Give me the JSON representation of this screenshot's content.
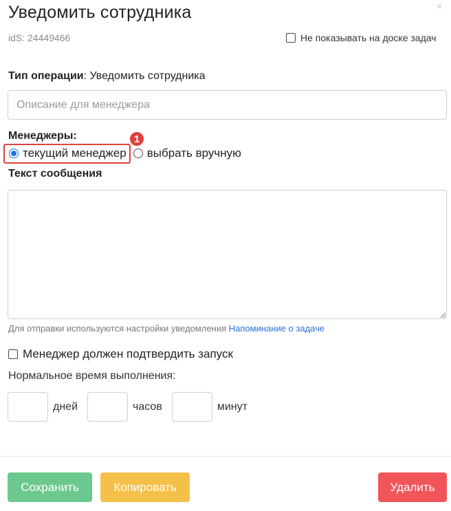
{
  "dialog": {
    "title": "Уведомить сотрудника",
    "close_glyph": "×",
    "ids_text": "idS: 24449466",
    "hide_checkbox_label": "Не показывать на доске задач",
    "hide_checkbox_checked": false
  },
  "operation": {
    "label": "Тип операции",
    "value": ": Уведомить сотрудника",
    "description_placeholder": "Описание для менеджера",
    "description_value": ""
  },
  "managers": {
    "label": "Менеджеры:",
    "options": [
      {
        "label": "текущий менеджер",
        "selected": true
      },
      {
        "label": "выбрать вручную",
        "selected": false
      }
    ],
    "annotation_badge": "1"
  },
  "message": {
    "label": "Текст сообщения",
    "value": "",
    "hint_prefix": "Для отправки используются настройки уведомления ",
    "hint_link": "Напоминание о задаче"
  },
  "confirm": {
    "label": "Менеджер должен подтвердить запуск",
    "checked": false
  },
  "normal_time": {
    "label": "Нормальное время выполнения:",
    "days_label": "дней",
    "hours_label": "часов",
    "minutes_label": "минут",
    "days_value": "",
    "hours_value": "",
    "minutes_value": ""
  },
  "buttons": {
    "save": "Сохранить",
    "copy": "Копировать",
    "delete": "Удалить"
  },
  "colors": {
    "save": "#6cc98e",
    "copy": "#f5c04a",
    "delete": "#f0555a",
    "link": "#2a6fd6",
    "highlight": "#e0403c",
    "radio_selected": "#1a73e8"
  },
  "icons": {
    "close": "close-icon"
  }
}
